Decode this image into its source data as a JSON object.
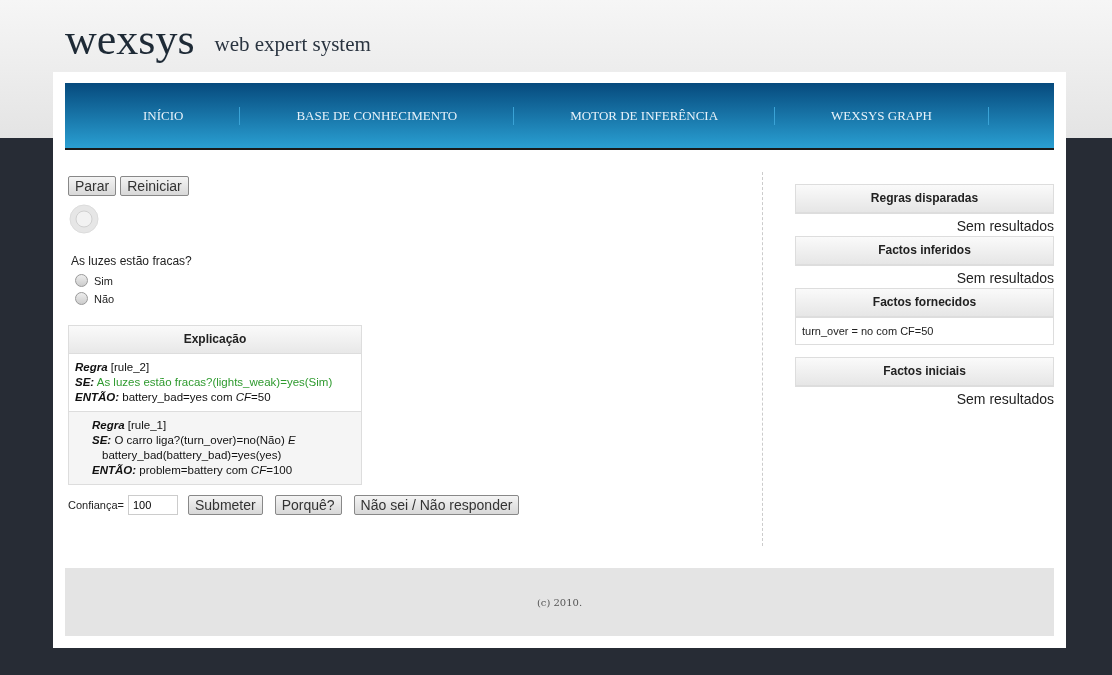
{
  "header": {
    "logo": "wexsys",
    "tagline": "web expert system"
  },
  "nav": [
    {
      "label": "INÍCIO"
    },
    {
      "label": "BASE DE CONHECIMENTO"
    },
    {
      "label": "MOTOR DE INFERÊNCIA"
    },
    {
      "label": "WEXSYS GRAPH"
    }
  ],
  "controls": [
    "Parar",
    "Reiniciar"
  ],
  "question": {
    "text": "As luzes estão fracas?",
    "options": [
      {
        "label": "Sim",
        "selected": false
      },
      {
        "label": "Não",
        "selected": false
      }
    ]
  },
  "explanation": {
    "title": "Explicação",
    "rules": [
      {
        "lines": [
          {
            "kind": "head",
            "keyword": "Regra",
            "text": "[rule_2]",
            "highlighted": false
          },
          {
            "kind": "line",
            "keyword": "SE:",
            "text": "As luzes estão fracas?(lights_weak)=yes(Sim)",
            "highlighted": true
          },
          {
            "kind": "line",
            "keyword": "ENTÃO:",
            "text": "battery_bad=yes com *CF*=50",
            "highlighted": false
          }
        ]
      },
      {
        "lines": [
          {
            "kind": "head",
            "keyword": "Regra",
            "text": "[rule_1]",
            "highlighted": false
          },
          {
            "kind": "line",
            "keyword": "SE:",
            "text": "O carro liga?(turn_over)=no(Não) *E*",
            "highlighted": false
          },
          {
            "kind": "continuation",
            "text": "battery_bad(battery_bad)=yes(yes)",
            "highlighted": false
          },
          {
            "kind": "line",
            "keyword": "ENTÃO:",
            "text": "problem=battery com *CF*=100",
            "highlighted": false
          }
        ]
      }
    ]
  },
  "answer": {
    "label": "Confiança=",
    "value": "100",
    "buttons": [
      "Submeter",
      "Porquê?",
      "Não sei / Não responder"
    ]
  },
  "panels": [
    {
      "title": "Regras disparadas",
      "kind": "empty",
      "text": "Sem resultados"
    },
    {
      "title": "Factos inferidos",
      "kind": "empty",
      "text": "Sem resultados"
    },
    {
      "title": "Factos fornecidos",
      "kind": "list",
      "items": [
        "turn_over = no com CF=50"
      ]
    },
    {
      "title": "Factos iniciais",
      "kind": "empty",
      "text": "Sem resultados"
    }
  ],
  "footer": "(c) 2010."
}
